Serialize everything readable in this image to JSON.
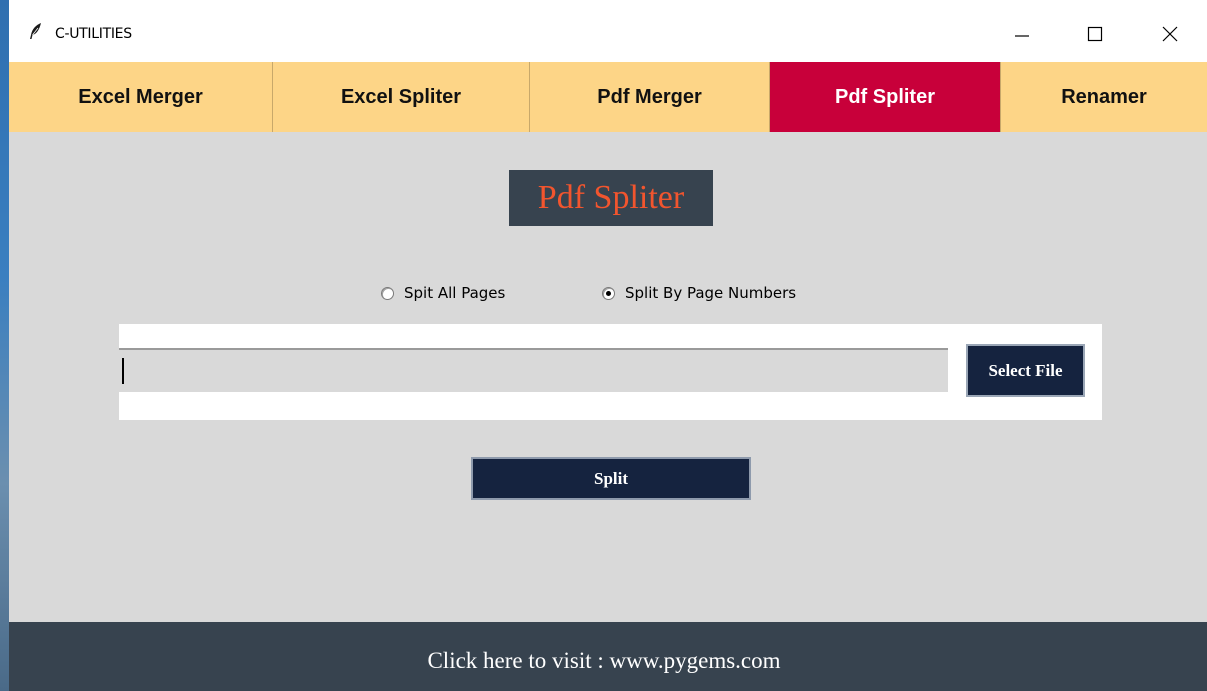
{
  "window": {
    "title": "C-UTILITIES",
    "icon": "feather-icon",
    "controls": [
      "minimize-icon",
      "maximize-icon",
      "close-icon"
    ]
  },
  "tabs": [
    {
      "label": "Excel Merger",
      "active": false
    },
    {
      "label": "Excel Spliter",
      "active": false
    },
    {
      "label": "Pdf Merger",
      "active": false
    },
    {
      "label": "Pdf Spliter",
      "active": true
    },
    {
      "label": "Renamer",
      "active": false
    }
  ],
  "main": {
    "heading": "Pdf Spliter",
    "options": [
      {
        "label": "Spit All Pages",
        "selected": false
      },
      {
        "label": "Split By Page Numbers",
        "selected": true
      }
    ],
    "file_input_value": "",
    "select_file_label": "Select File",
    "split_label": "Split"
  },
  "footer": {
    "link_text": "Click here to visit : www.pygems.com"
  },
  "colors": {
    "tab_bg": "#fdd587",
    "tab_active_bg": "#c8003a",
    "content_bg": "#d9d9d9",
    "heading_bg": "#37434f",
    "heading_text": "#f2552e",
    "button_bg": "#15233f",
    "footer_bg": "#37434f"
  }
}
